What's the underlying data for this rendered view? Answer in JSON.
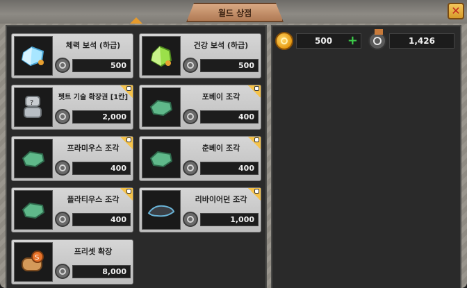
{
  "window": {
    "title": "월드 상점"
  },
  "currency": {
    "gold": "500",
    "medals": "1,426"
  },
  "items": [
    {
      "name": "체력 보석 (하급)",
      "price": "500",
      "icon": "blue-gem-icon",
      "locked": false
    },
    {
      "name": "건강 보석 (하급)",
      "price": "500",
      "icon": "green-gem-icon",
      "locked": false
    },
    {
      "name": "펫트 기술 확장권 [1칸]",
      "price": "2,000",
      "icon": "skill-scroll-icon",
      "locked": true
    },
    {
      "name": "포베이 조각",
      "price": "400",
      "icon": "green-fragment-icon",
      "locked": true
    },
    {
      "name": "프라미우스 조각",
      "price": "400",
      "icon": "green-fragment-icon",
      "locked": true
    },
    {
      "name": "춘베이 조각",
      "price": "400",
      "icon": "green-fragment-icon",
      "locked": true
    },
    {
      "name": "플라티우스 조각",
      "price": "400",
      "icon": "green-fragment-icon",
      "locked": true
    },
    {
      "name": "리바이어던 조각",
      "price": "1,000",
      "icon": "dark-fragment-icon",
      "locked": true
    },
    {
      "name": "프리셋 확장",
      "price": "8,000",
      "icon": "preset-scroll-icon",
      "locked": false
    }
  ],
  "colors": {
    "accent": "#e69a2c",
    "plus": "#3cd04a",
    "lock": "#f6c34a"
  }
}
